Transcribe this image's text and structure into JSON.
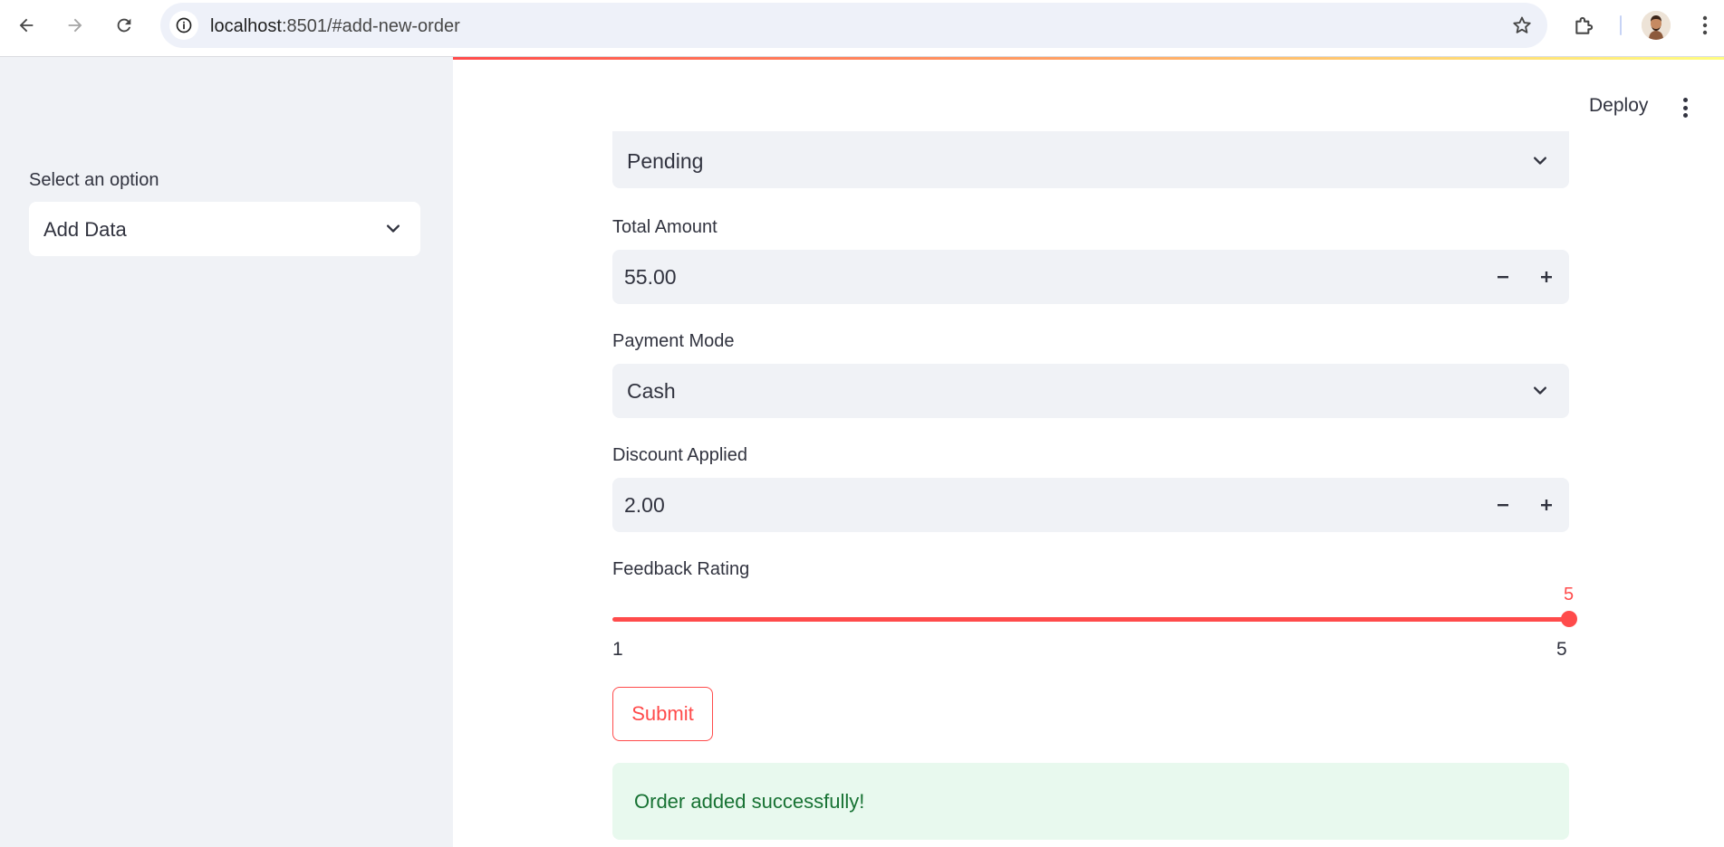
{
  "browser": {
    "url_host": "localhost",
    "url_rest": ":8501/#add-new-order"
  },
  "sidebar": {
    "select_label": "Select an option",
    "select_value": "Add Data"
  },
  "header": {
    "deploy_label": "Deploy"
  },
  "form": {
    "status_value": "Pending",
    "total_amount": {
      "label": "Total Amount",
      "value": "55.00"
    },
    "payment_mode": {
      "label": "Payment Mode",
      "value": "Cash"
    },
    "discount": {
      "label": "Discount Applied",
      "value": "2.00"
    },
    "feedback": {
      "label": "Feedback Rating",
      "value": "5",
      "min": "1",
      "max": "5",
      "fraction": 1.0
    },
    "submit_label": "Submit"
  },
  "alert": {
    "message": "Order added successfully!"
  },
  "colors": {
    "accent": "#ff4b4b",
    "success_bg": "#e8f9ee",
    "success_text": "#177233",
    "sidebar_bg": "#f0f2f6"
  },
  "icons": {
    "back": "arrow-left-icon",
    "forward": "arrow-right-icon",
    "reload": "reload-icon",
    "site_info": "info-icon",
    "bookmark": "star-icon",
    "extensions": "puzzle-icon",
    "menu": "kebab-icon",
    "chevron": "chevron-down-icon"
  }
}
